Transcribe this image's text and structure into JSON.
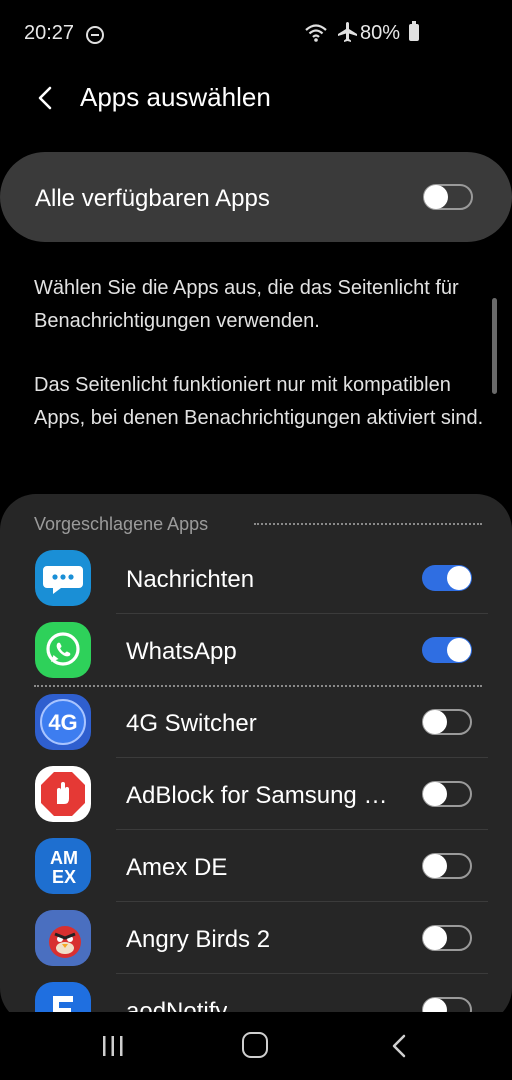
{
  "status_bar": {
    "time": "20:27",
    "battery": "80%"
  },
  "header": {
    "title": "Apps auswählen"
  },
  "all_apps": {
    "label": "Alle verfügbaren Apps",
    "enabled": false
  },
  "description": {
    "p1": "Wählen Sie die Apps aus, die das Seitenlicht für Benachrichtigungen verwenden.",
    "p2": "Das Seitenlicht funktioniert nur mit kompatiblen Apps, bei denen Benachrichtigungen aktiviert sind."
  },
  "suggested_header": "Vorgeschlagene Apps",
  "apps": [
    {
      "name": "Nachrichten",
      "enabled": true,
      "icon": "messages-icon",
      "icon_color": "#1a8fd6"
    },
    {
      "name": "WhatsApp",
      "enabled": true,
      "icon": "whatsapp-icon",
      "icon_color": "#2ed15a"
    },
    {
      "name": "4G Switcher",
      "enabled": false,
      "icon": "4g-switcher-icon",
      "icon_color": "#2f5fcf"
    },
    {
      "name": "AdBlock for Samsung Internet",
      "enabled": false,
      "icon": "adblock-icon",
      "icon_color": "#e53935"
    },
    {
      "name": "Amex DE",
      "enabled": false,
      "icon": "amex-icon",
      "icon_color": "#1e6fd0"
    },
    {
      "name": "Angry Birds 2",
      "enabled": false,
      "icon": "angry-birds-icon",
      "icon_color": "#3a4fa0"
    },
    {
      "name": "aodNotify",
      "enabled": false,
      "icon": "aodnotify-icon",
      "icon_color": "#1f6fe0"
    }
  ],
  "colors": {
    "accent": "#2f6ee2",
    "card": "#262626",
    "background": "#000000"
  }
}
